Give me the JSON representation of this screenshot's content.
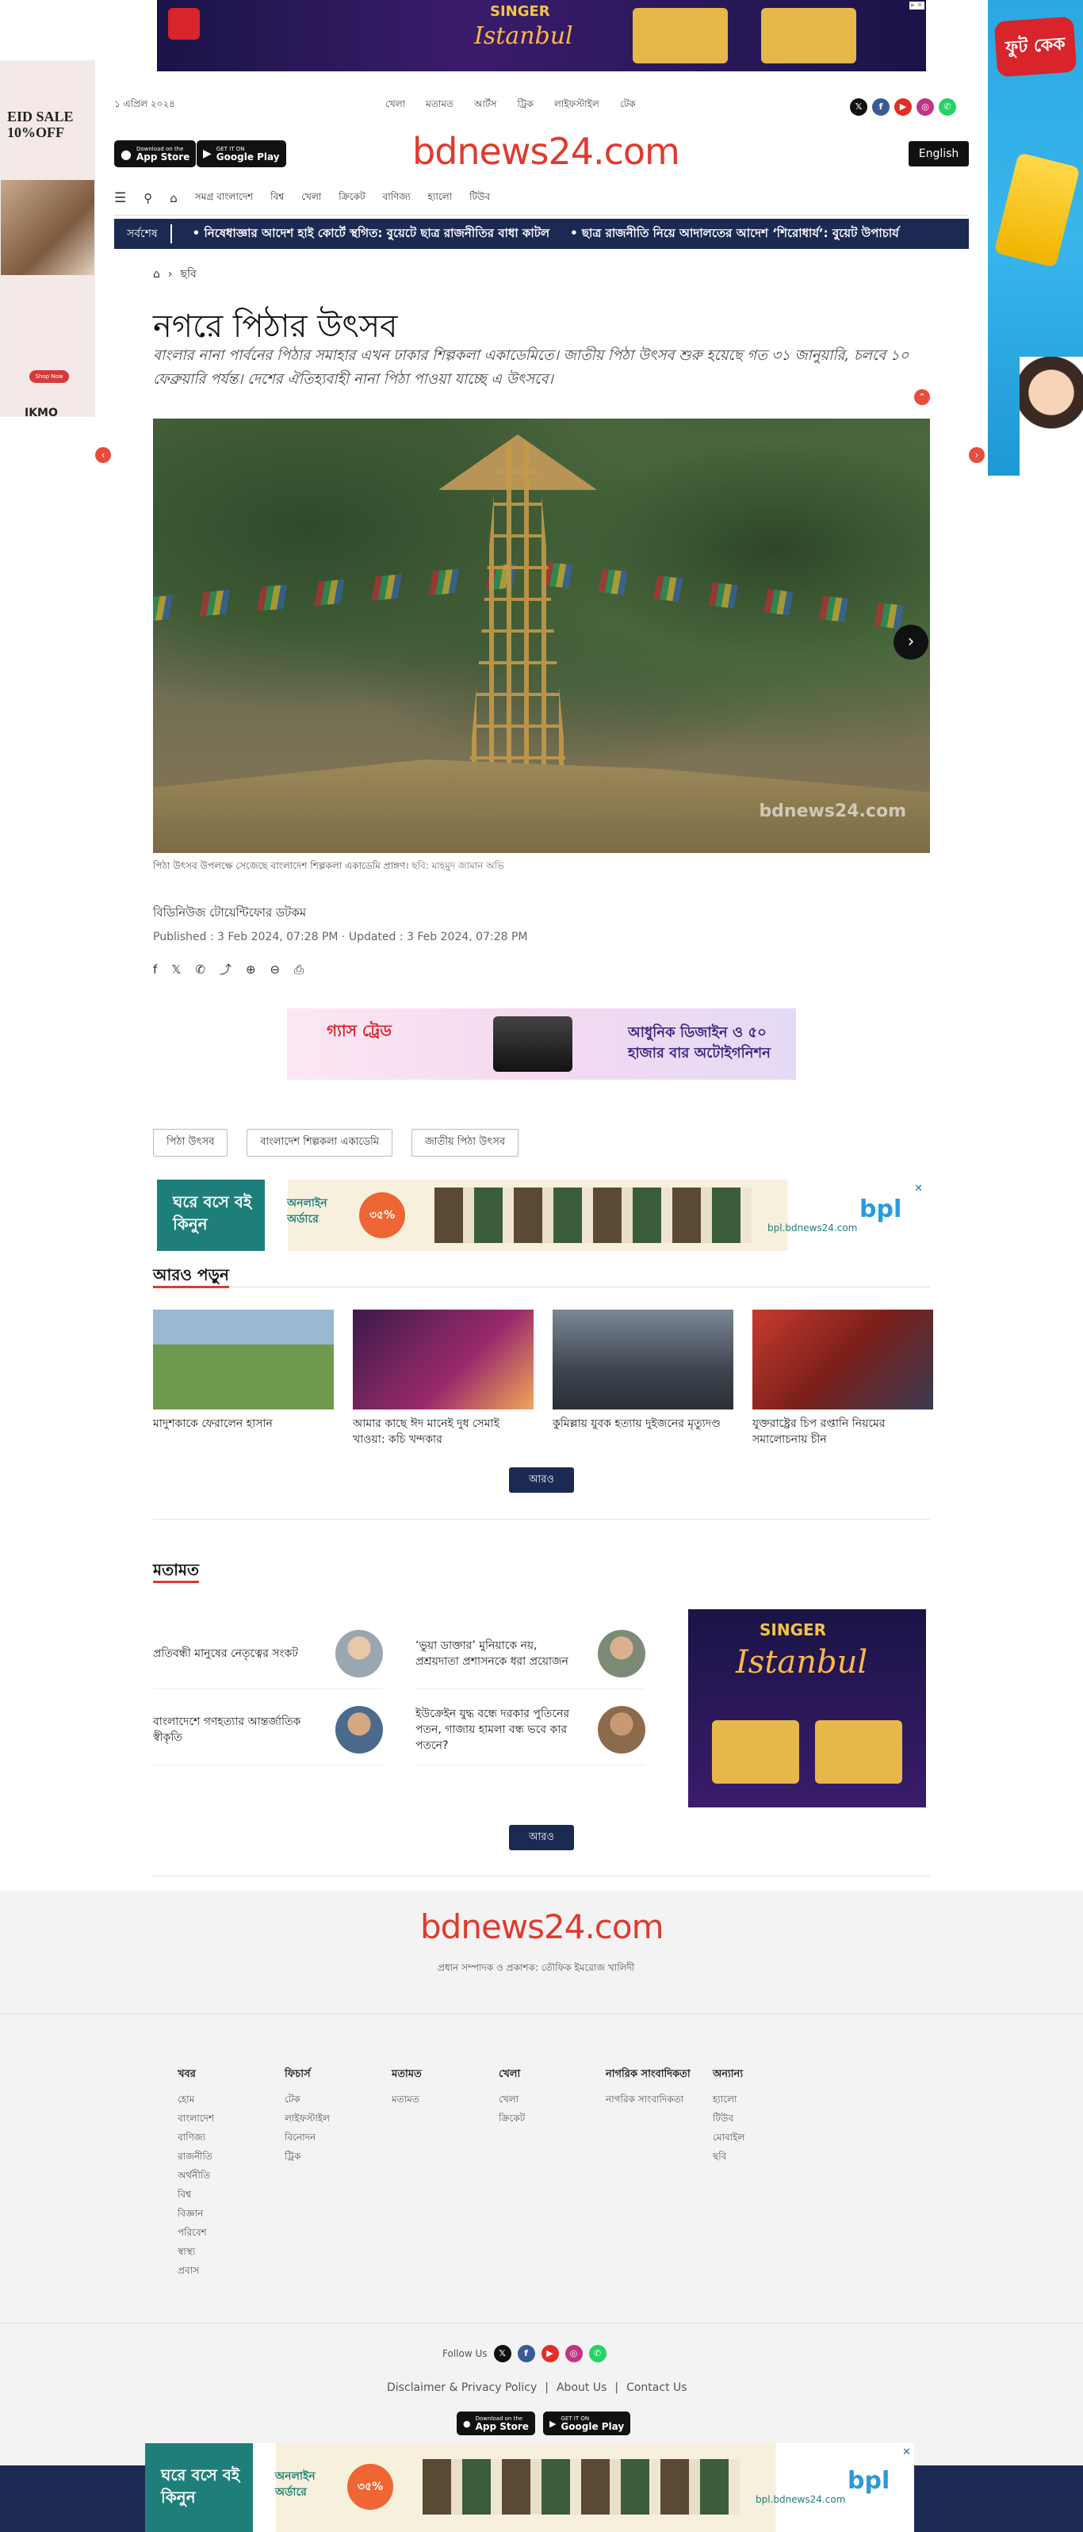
{
  "ads": {
    "left_side": {
      "text_line1": "EID SALE",
      "text_line2": "10%OFF",
      "button": "Shop Now",
      "logo": "IKMO"
    },
    "right_side": {
      "brand": "ফুট কেক"
    },
    "top_banner": {
      "brand": "SINGER",
      "headline": "Istanbul",
      "close": "▸ ✕"
    },
    "mid_banner": {
      "brand": "গ্যাস ট্রেড",
      "text": "আধুনিক ডিজাইন ও ৫০ হাজার বার অটোইগনিশন"
    },
    "bpl": {
      "line1": "ঘরে বসে বই কিনুন",
      "line2": "অনলাইন অর্ডারে",
      "discount": "৩৫%",
      "url": "bpl.bdnews24.com",
      "logo": "bpl",
      "close": "✕"
    }
  },
  "header": {
    "date": "১ এপ্রিল ২০২৪",
    "top_links": [
      "খেলা",
      "মতামত",
      "আর্টস",
      "ট্রিক",
      "লাইফস্টাইল",
      "টেক"
    ],
    "logo": "bdnews24.com",
    "app_store": {
      "small": "Download on the",
      "big": "App Store"
    },
    "google_play": {
      "small": "GET IT ON",
      "big": "Google Play"
    },
    "english_button": "English",
    "main_nav": [
      "সমগ্র বাংলাদেশ",
      "বিশ্ব",
      "খেলা",
      "ক্রিকেট",
      "বাণিজ্য",
      "হ্যালো",
      "টিউব"
    ],
    "ticker_label": "সর্বশেষ",
    "ticker_items": [
      "নিষেধাজ্ঞার আদেশ হাই কোর্টে স্থগিত: বুয়েটে ছাত্র রাজনীতির বাধা কাটল",
      "ছাত্র রাজনীতি নিয়ে আদালতের আদেশ ‘শিরোধার্য’: বুয়েট উপাচার্য"
    ]
  },
  "article": {
    "breadcrumb": "ছবি",
    "title": "নগরে পিঠার উৎসব",
    "lead": "বাংলার নানা পার্বনের পিঠার সমাহার এখন ঢাকার শিল্পকলা একাডেমিতে। জাতীয় পিঠা উৎসব শুরু হয়েছে গত ৩১ জানুয়ারি, চলবে ১০ ফেব্রুয়ারি পর্যন্ত। দেশের ঐতিহ্যবাহী নানা পিঠা পাওয়া যাচ্ছে এ উৎসবে।",
    "image_caption": "পিঠা উৎসব উপলক্ষে সেজেছে বাংলাদেশ শিল্পকলা একাডেমি প্রাঙ্গণ।",
    "image_credit": "ছবি: মাহমুদ জামান অভি",
    "image_watermark": "bdnews24.com",
    "author": "বিডিনিউজ টোয়েন্টিফোর ডটকম",
    "published": "Published : 3 Feb 2024, 07:28 PM",
    "updated": "Updated : 3 Feb 2024, 07:28 PM",
    "tags": [
      "পিঠা উৎসব",
      "বাংলাদেশ শিল্পকলা একাডেমি",
      "জাতীয় পিঠা উৎসব"
    ]
  },
  "more": {
    "heading": "আরও পড়ুন",
    "cards": [
      {
        "title": "মাদুশকাকে ফেরালেন হাসান",
        "color": "#7fa25a"
      },
      {
        "title": "আমার কাছে ঈদ মানেই দুধ সেমাই খাওয়া: কচি খন্দকার",
        "color": "#6e2a5a"
      },
      {
        "title": "কুমিল্লায় যুবক হত্যায় দুইজনের মৃত্যুদণ্ড",
        "color": "#5a6470"
      },
      {
        "title": "যুক্তরাষ্ট্রের চিপ রপ্তানি নিয়মের সমালোচনায় চীন",
        "color": "#b0372c"
      }
    ],
    "button": "আরও"
  },
  "opinion": {
    "heading": "মতামত",
    "items": [
      {
        "title": "প্রতিবন্ধী মানুষের নেতৃত্বের সংকট",
        "avatar": "#9aa6b0"
      },
      {
        "title": "‘ভুয়া ডাক্তার’ মুনিয়াকে নয়, প্রশ্রয়দাতা প্রশাসনকে ধরা প্রয়োজন",
        "avatar": "#7c8a76"
      },
      {
        "title": "বাংলাদেশে গণহত্যার আন্তর্জাতিক স্বীকৃতি",
        "avatar": "#4c6a8c"
      },
      {
        "title": "ইউক্রেইন যুদ্ধ বন্ধে দরকার পুতিনের পতন, গাজায় হামলা বন্ধ ভবে কার পতনে?",
        "avatar": "#8c6a4c"
      }
    ],
    "button": "আরও"
  },
  "footer": {
    "logo": "bdnews24.com",
    "subtitle": "প্রধান সম্পাদক ও প্রকাশক: তৌফিক ইমরোজ খালিদী",
    "columns": [
      {
        "title": "খবর",
        "links": [
          "হোম",
          "বাংলাদেশ",
          "বাণিজ্য",
          "রাজনীতি",
          "অর্থনীতি",
          "বিশ্ব",
          "বিজ্ঞান",
          "পরিবেশ",
          "স্বাস্থ্য",
          "প্রবাস"
        ]
      },
      {
        "title": "ফিচার্স",
        "links": [
          "টেক",
          "লাইফস্টাইল",
          "বিনোদন",
          "ট্রিক"
        ]
      },
      {
        "title": "মতামত",
        "links": [
          "মতামত"
        ]
      },
      {
        "title": "খেলা",
        "links": [
          "খেলা",
          "ক্রিকেট"
        ]
      },
      {
        "title": "নাগরিক সাংবাদিকতা",
        "links": [
          "নাগরিক সাংবাদিকতা"
        ]
      },
      {
        "title": "অন্যান্য",
        "links": [
          "হ্যালো",
          "টিউব",
          "মোবাইল",
          "ছবি"
        ]
      }
    ],
    "follow_label": "Follow Us",
    "links": [
      "Disclaimer & Privacy Policy",
      "About Us",
      "Contact Us"
    ]
  },
  "colors": {
    "brand_red": "#e03a2e",
    "navy": "#1c2a53"
  }
}
